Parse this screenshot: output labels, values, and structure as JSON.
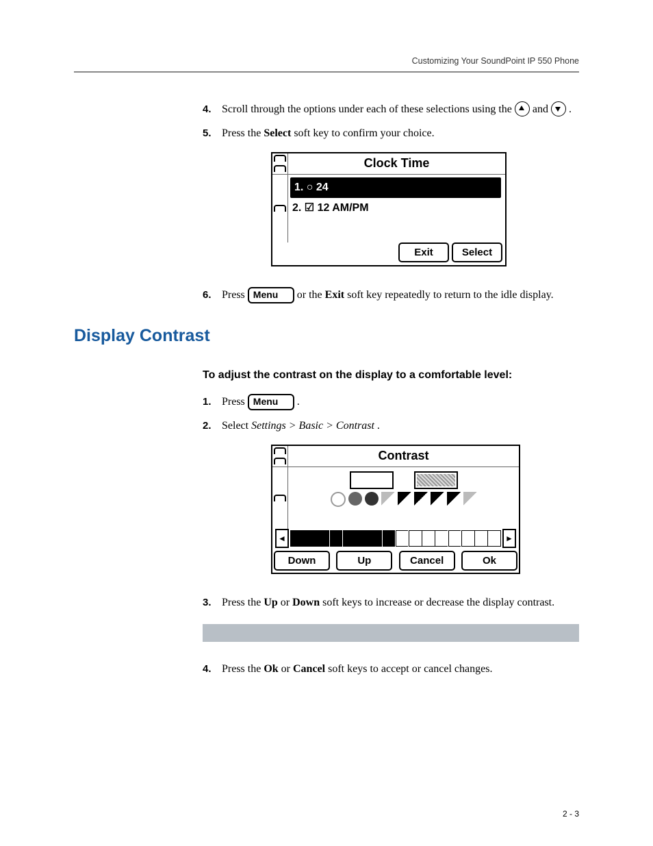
{
  "header": {
    "title": "Customizing Your SoundPoint IP 550 Phone"
  },
  "steps_top": {
    "s4": {
      "num": "4.",
      "pre": "Scroll through the options under each of these selections using the ",
      "mid": " and ",
      "post": " ."
    },
    "s5": {
      "num": "5.",
      "pre": "Press the ",
      "bold": "Select",
      "post": " soft key to confirm your choice."
    },
    "s6": {
      "num": "6.",
      "pre": "Press ",
      "menu": "Menu",
      "mid": " or the ",
      "bold": "Exit",
      "post": " soft key repeatedly to return to the idle display."
    }
  },
  "lcd_clock": {
    "title": "Clock Time",
    "row1": "1. ○  24",
    "row2": "2. ☑  12 AM/PM",
    "sk_exit": "Exit",
    "sk_select": "Select"
  },
  "section_heading": "Display Contrast",
  "sub_heading": "To adjust the contrast on the display to a comfortable level:",
  "steps_contrast": {
    "s1": {
      "num": "1.",
      "pre": "Press ",
      "menu": "Menu",
      "post": " ."
    },
    "s2": {
      "num": "2.",
      "pre": "Select ",
      "ital": "Settings > Basic > Contrast",
      "post": "."
    },
    "s3": {
      "num": "3.",
      "pre": "Press the ",
      "b1": "Up",
      "mid1": " or ",
      "b2": "Down",
      "mid2": " soft keys to increase or decrease the display contrast."
    },
    "s4": {
      "num": "4.",
      "pre": "Press the ",
      "b1": "Ok",
      "mid1": " or ",
      "b2": "Cancel",
      "mid2": " soft keys to accept or cancel changes."
    }
  },
  "lcd_contrast": {
    "title": "Contrast",
    "left_arrow": "◄",
    "right_arrow": "►",
    "sk_down": "Down",
    "sk_up": "Up",
    "sk_cancel": "Cancel",
    "sk_ok": "Ok"
  },
  "page_num": "2 - 3"
}
